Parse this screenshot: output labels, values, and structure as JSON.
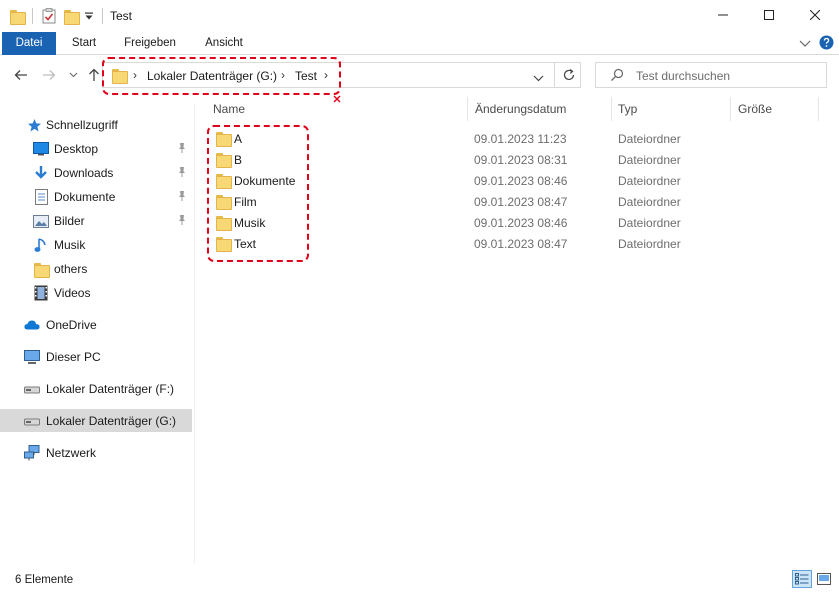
{
  "window": {
    "title": "Test",
    "controls": {
      "minimize_icon": "minimize-icon",
      "maximize_icon": "maximize-icon",
      "close_icon": "close-icon"
    }
  },
  "ribbon": {
    "tabs": [
      {
        "label": "Datei",
        "active": true
      },
      {
        "label": "Start"
      },
      {
        "label": "Freigeben"
      },
      {
        "label": "Ansicht"
      }
    ]
  },
  "address": {
    "breadcrumbs": [
      "Lokaler Datenträger (G:)",
      "Test"
    ],
    "search_placeholder": "Test durchsuchen"
  },
  "nav": {
    "items": [
      {
        "label": "Schnellzugriff",
        "icon": "star-icon"
      },
      {
        "label": "Desktop",
        "icon": "desktop-icon",
        "pinned": true
      },
      {
        "label": "Downloads",
        "icon": "download-icon",
        "pinned": true
      },
      {
        "label": "Dokumente",
        "icon": "document-icon",
        "pinned": true
      },
      {
        "label": "Bilder",
        "icon": "picture-icon",
        "pinned": true
      },
      {
        "label": "Musik",
        "icon": "music-icon"
      },
      {
        "label": "others",
        "icon": "folder-icon"
      },
      {
        "label": "Videos",
        "icon": "video-icon"
      },
      {
        "label": "OneDrive",
        "icon": "cloud-icon"
      },
      {
        "label": "Dieser PC",
        "icon": "computer-icon"
      },
      {
        "label": "Lokaler Datenträger (F:)",
        "icon": "drive-icon"
      },
      {
        "label": "Lokaler Datenträger (G:)",
        "icon": "drive-icon",
        "selected": true
      },
      {
        "label": "Netzwerk",
        "icon": "network-icon"
      }
    ]
  },
  "columns": {
    "name": "Name",
    "date": "Änderungsdatum",
    "type": "Typ",
    "size": "Größe"
  },
  "files": [
    {
      "name": "A",
      "date": "09.01.2023 11:23",
      "type": "Dateiordner"
    },
    {
      "name": "B",
      "date": "09.01.2023 08:31",
      "type": "Dateiordner"
    },
    {
      "name": "Dokumente",
      "date": "09.01.2023 08:46",
      "type": "Dateiordner"
    },
    {
      "name": "Film",
      "date": "09.01.2023 08:47",
      "type": "Dateiordner"
    },
    {
      "name": "Musik",
      "date": "09.01.2023 08:46",
      "type": "Dateiordner"
    },
    {
      "name": "Text",
      "date": "09.01.2023 08:47",
      "type": "Dateiordner"
    }
  ],
  "status": {
    "count_text": "6 Elemente"
  },
  "colors": {
    "accent": "#1a63b3",
    "highlight": "#e0001a",
    "folder": "#f8d775"
  }
}
